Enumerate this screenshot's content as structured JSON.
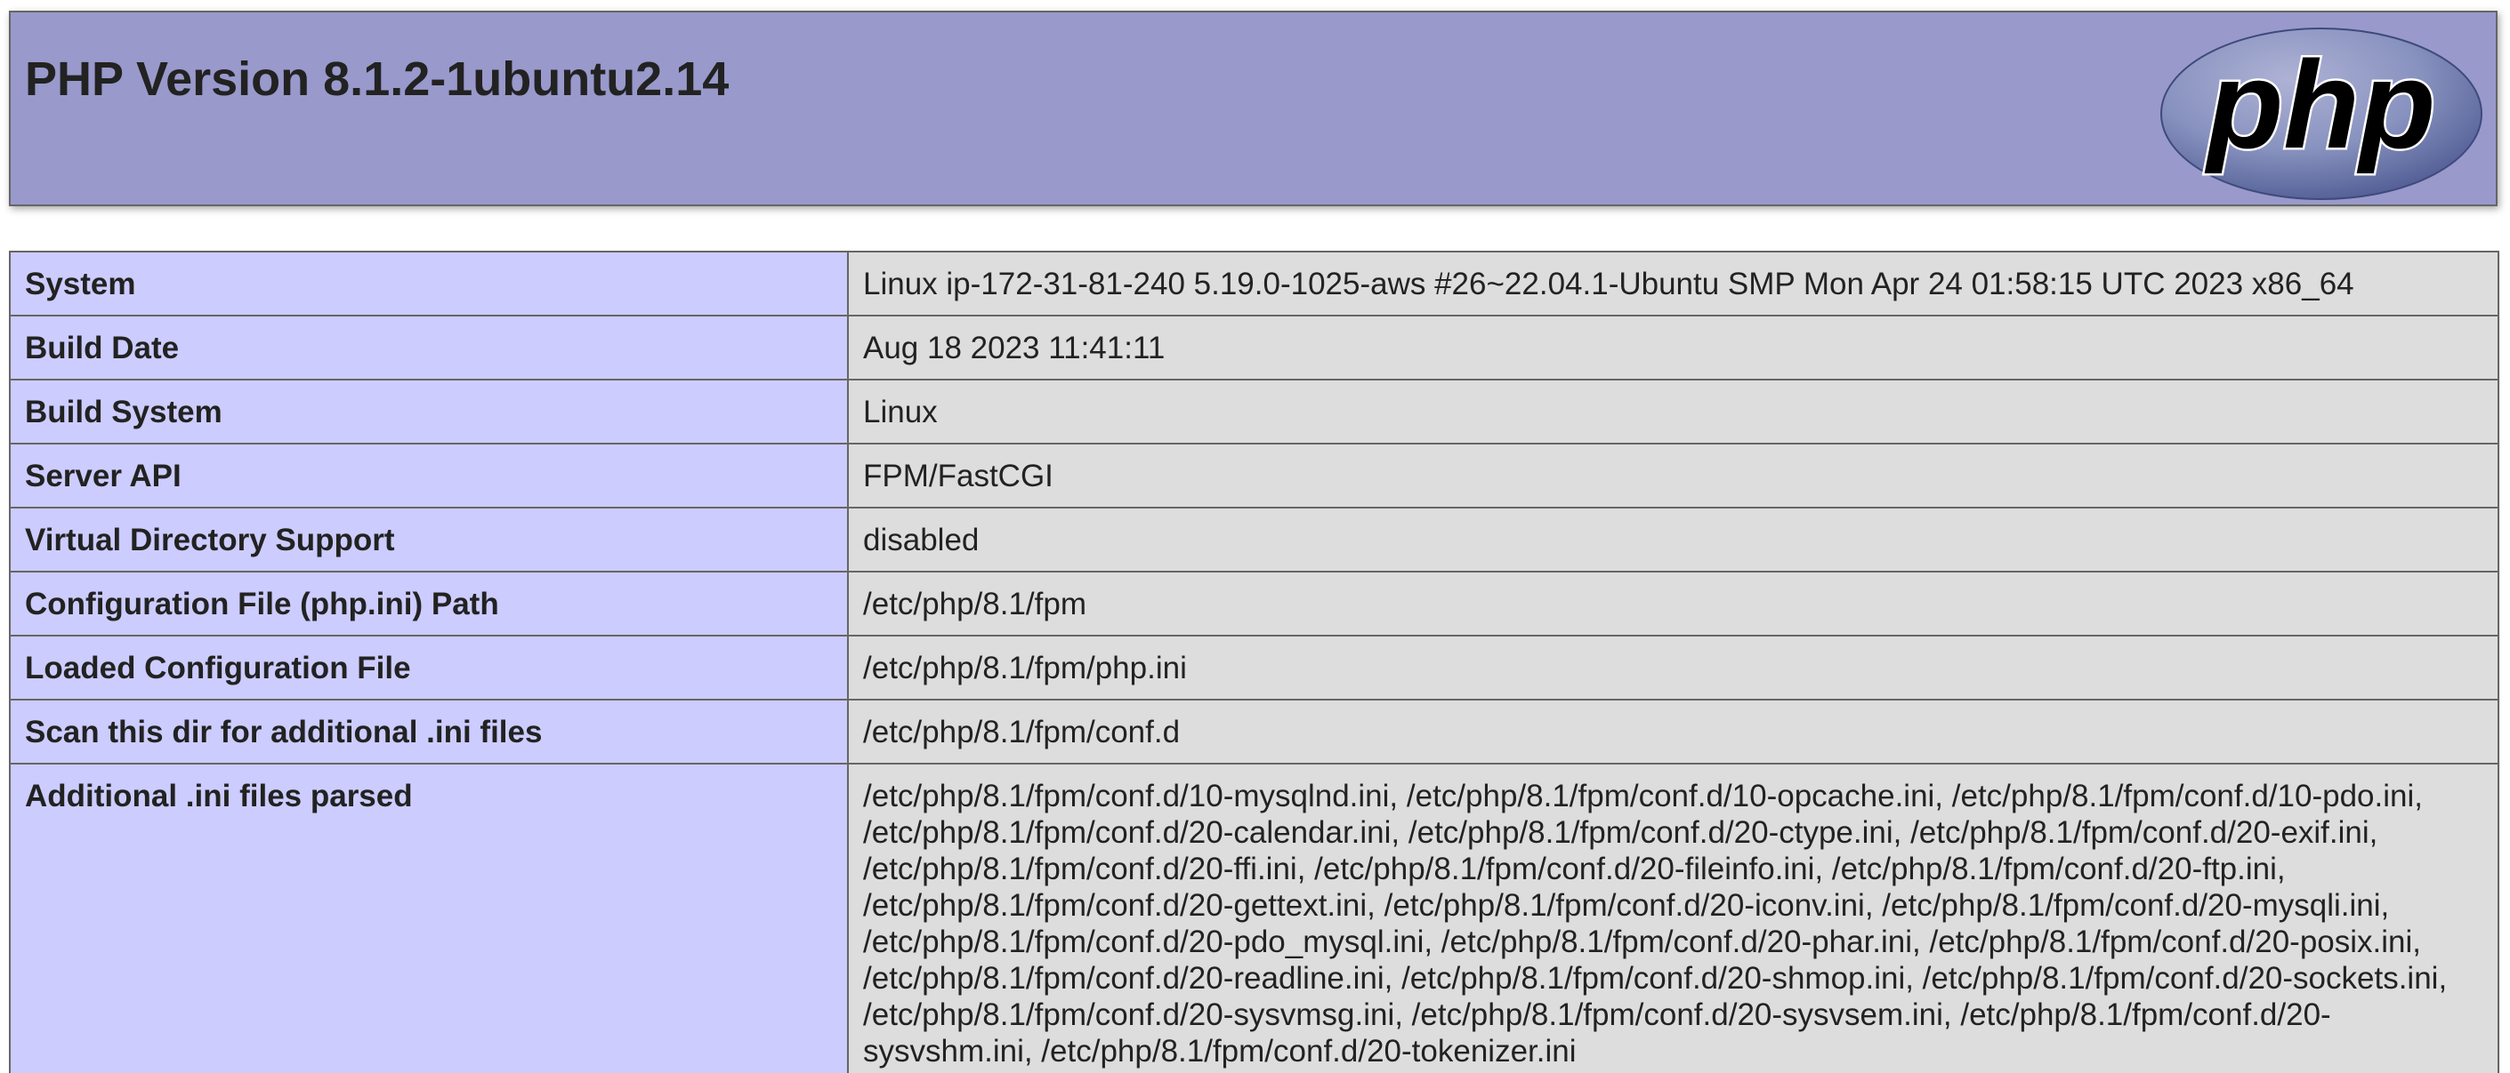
{
  "header": {
    "title": "PHP Version 8.1.2-1ubuntu2.14",
    "logo_text": "php",
    "logo_bg": "#7a86b8",
    "bg": "#9999cc"
  },
  "rows": [
    {
      "label": "System",
      "value": "Linux ip-172-31-81-240 5.19.0-1025-aws #26~22.04.1-Ubuntu SMP Mon Apr 24 01:58:15 UTC 2023 x86_64"
    },
    {
      "label": "Build Date",
      "value": "Aug 18 2023 11:41:11"
    },
    {
      "label": "Build System",
      "value": "Linux"
    },
    {
      "label": "Server API",
      "value": "FPM/FastCGI"
    },
    {
      "label": "Virtual Directory Support",
      "value": "disabled"
    },
    {
      "label": "Configuration File (php.ini) Path",
      "value": "/etc/php/8.1/fpm"
    },
    {
      "label": "Loaded Configuration File",
      "value": "/etc/php/8.1/fpm/php.ini"
    },
    {
      "label": "Scan this dir for additional .ini files",
      "value": "/etc/php/8.1/fpm/conf.d"
    },
    {
      "label": "Additional .ini files parsed",
      "value": "/etc/php/8.1/fpm/conf.d/10-mysqlnd.ini, /etc/php/8.1/fpm/conf.d/10-opcache.ini, /etc/php/8.1/fpm/conf.d/10-pdo.ini, /etc/php/8.1/fpm/conf.d/20-calendar.ini, /etc/php/8.1/fpm/conf.d/20-ctype.ini, /etc/php/8.1/fpm/conf.d/20-exif.ini, /etc/php/8.1/fpm/conf.d/20-ffi.ini, /etc/php/8.1/fpm/conf.d/20-fileinfo.ini, /etc/php/8.1/fpm/conf.d/20-ftp.ini, /etc/php/8.1/fpm/conf.d/20-gettext.ini, /etc/php/8.1/fpm/conf.d/20-iconv.ini, /etc/php/8.1/fpm/conf.d/20-mysqli.ini, /etc/php/8.1/fpm/conf.d/20-pdo_mysql.ini, /etc/php/8.1/fpm/conf.d/20-phar.ini, /etc/php/8.1/fpm/conf.d/20-posix.ini, /etc/php/8.1/fpm/conf.d/20-readline.ini, /etc/php/8.1/fpm/conf.d/20-shmop.ini, /etc/php/8.1/fpm/conf.d/20-sockets.ini, /etc/php/8.1/fpm/conf.d/20-sysvmsg.ini, /etc/php/8.1/fpm/conf.d/20-sysvsem.ini, /etc/php/8.1/fpm/conf.d/20-sysvshm.ini, /etc/php/8.1/fpm/conf.d/20-tokenizer.ini"
    }
  ],
  "colors": {
    "label_bg": "#ccccff",
    "value_bg": "#dddddd",
    "border": "#666666"
  }
}
